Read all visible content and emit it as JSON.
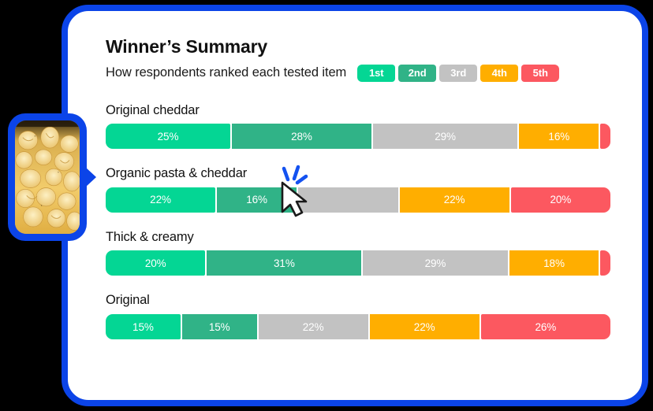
{
  "header": {
    "title": "Winner’s Summary",
    "subtitle": "How respondents ranked each tested item"
  },
  "legend": {
    "items": [
      {
        "label": "1st",
        "color": "#04d694"
      },
      {
        "label": "2nd",
        "color": "#30b387"
      },
      {
        "label": "3rd",
        "color": "#c2c2c2"
      },
      {
        "label": "4th",
        "color": "#ffae00"
      },
      {
        "label": "5th",
        "color": "#fc5860"
      }
    ]
  },
  "thumbnail": {
    "alt": "macaroni-and-cheese-photo",
    "border_color": "#0b44e8"
  },
  "cursor": {
    "state": "click",
    "accent_color": "#1452f0"
  },
  "card": {
    "background": "#ffffff",
    "border_color": "#0b44e8"
  },
  "chart_data": {
    "type": "bar",
    "title": "Winner’s Summary",
    "subtitle": "How respondents ranked each tested item",
    "orientation": "horizontal-stacked",
    "unit": "percent",
    "xlabel": "",
    "ylabel": "",
    "xlim": [
      0,
      100
    ],
    "grid": false,
    "legend_position": "top-right",
    "categories": [
      "Original cheddar",
      "Organic pasta & cheddar",
      "Thick & creamy",
      "Original"
    ],
    "series": [
      {
        "name": "1st",
        "color": "#04d694",
        "values": [
          25,
          22,
          20,
          15
        ],
        "labels": [
          "25%",
          "22%",
          "20%",
          "15%"
        ]
      },
      {
        "name": "2nd",
        "color": "#30b387",
        "values": [
          28,
          16,
          31,
          15
        ],
        "labels": [
          "28%",
          "16%",
          "31%",
          "15%"
        ]
      },
      {
        "name": "3rd",
        "color": "#c2c2c2",
        "values": [
          29,
          20,
          29,
          22
        ],
        "labels": [
          "29%",
          "",
          "29%",
          "22%"
        ]
      },
      {
        "name": "4th",
        "color": "#ffae00",
        "values": [
          16,
          22,
          18,
          22
        ],
        "labels": [
          "16%",
          "22%",
          "18%",
          "22%"
        ]
      },
      {
        "name": "5th",
        "color": "#fc5860",
        "values": [
          2,
          20,
          2,
          26
        ],
        "labels": [
          "",
          "20%",
          "",
          "26%"
        ]
      }
    ],
    "rows": [
      {
        "label": "Original cheddar",
        "segments": [
          {
            "rank": "1st",
            "value": 25,
            "label": "25%",
            "color": "#04d694"
          },
          {
            "rank": "2nd",
            "value": 28,
            "label": "28%",
            "color": "#30b387"
          },
          {
            "rank": "3rd",
            "value": 29,
            "label": "29%",
            "color": "#c2c2c2"
          },
          {
            "rank": "4th",
            "value": 16,
            "label": "16%",
            "color": "#ffae00"
          },
          {
            "rank": "5th",
            "value": 2,
            "label": "",
            "color": "#fc5860"
          }
        ]
      },
      {
        "label": "Organic pasta & cheddar",
        "segments": [
          {
            "rank": "1st",
            "value": 22,
            "label": "22%",
            "color": "#04d694"
          },
          {
            "rank": "2nd",
            "value": 16,
            "label": "16%",
            "color": "#30b387"
          },
          {
            "rank": "3rd",
            "value": 20,
            "label": "",
            "color": "#c2c2c2"
          },
          {
            "rank": "4th",
            "value": 22,
            "label": "22%",
            "color": "#ffae00"
          },
          {
            "rank": "5th",
            "value": 20,
            "label": "20%",
            "color": "#fc5860"
          }
        ]
      },
      {
        "label": "Thick & creamy",
        "segments": [
          {
            "rank": "1st",
            "value": 20,
            "label": "20%",
            "color": "#04d694"
          },
          {
            "rank": "2nd",
            "value": 31,
            "label": "31%",
            "color": "#30b387"
          },
          {
            "rank": "3rd",
            "value": 29,
            "label": "29%",
            "color": "#c2c2c2"
          },
          {
            "rank": "4th",
            "value": 18,
            "label": "18%",
            "color": "#ffae00"
          },
          {
            "rank": "5th",
            "value": 2,
            "label": "",
            "color": "#fc5860"
          }
        ]
      },
      {
        "label": "Original",
        "segments": [
          {
            "rank": "1st",
            "value": 15,
            "label": "15%",
            "color": "#04d694"
          },
          {
            "rank": "2nd",
            "value": 15,
            "label": "15%",
            "color": "#30b387"
          },
          {
            "rank": "3rd",
            "value": 22,
            "label": "22%",
            "color": "#c2c2c2"
          },
          {
            "rank": "4th",
            "value": 22,
            "label": "22%",
            "color": "#ffae00"
          },
          {
            "rank": "5th",
            "value": 26,
            "label": "26%",
            "color": "#fc5860"
          }
        ]
      }
    ]
  }
}
